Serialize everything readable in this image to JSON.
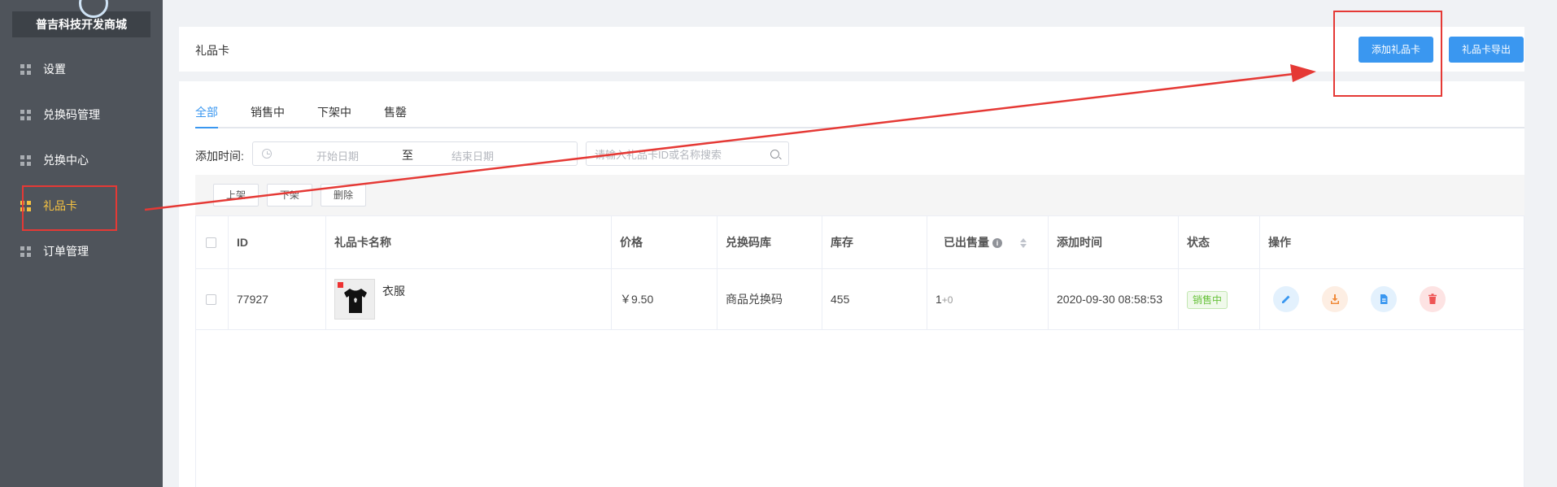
{
  "sidebar": {
    "brand": "普吉科技开发商城",
    "items": [
      {
        "label": "设置",
        "icon": "grid-icon",
        "active": false
      },
      {
        "label": "兑换码管理",
        "icon": "grid-icon",
        "active": false
      },
      {
        "label": "兑换中心",
        "icon": "grid-icon",
        "active": false
      },
      {
        "label": "礼品卡",
        "icon": "grid-icon",
        "active": true
      },
      {
        "label": "订单管理",
        "icon": "grid-icon",
        "active": false
      }
    ]
  },
  "header": {
    "title": "礼品卡",
    "add_button": "添加礼品卡",
    "export_button": "礼品卡导出"
  },
  "tabs": [
    "全部",
    "销售中",
    "下架中",
    "售罄"
  ],
  "filters": {
    "date_label": "添加时间:",
    "start_placeholder": "开始日期",
    "separator": "至",
    "end_placeholder": "结束日期",
    "search_placeholder": "请输入礼品卡ID或名称搜索"
  },
  "toolbar": {
    "on_shelf": "上架",
    "off_shelf": "下架",
    "delete": "删除"
  },
  "table": {
    "columns": [
      "ID",
      "礼品卡名称",
      "价格",
      "兑换码库",
      "库存",
      "已出售量",
      "添加时间",
      "状态",
      "操作"
    ],
    "rows": [
      {
        "id": "77927",
        "name": "衣服",
        "price": "￥9.50",
        "code_library": "商品兑换码",
        "stock": "455",
        "sold": "1",
        "sold_extra": "+0",
        "added_time": "2020-09-30 08:58:53",
        "status": "销售中"
      }
    ]
  },
  "colors": {
    "primary": "#3a97f0",
    "sidebar_bg": "#4f545b",
    "active_nav": "#f5c242",
    "annotation": "#e53935",
    "success": "#67c23a"
  }
}
